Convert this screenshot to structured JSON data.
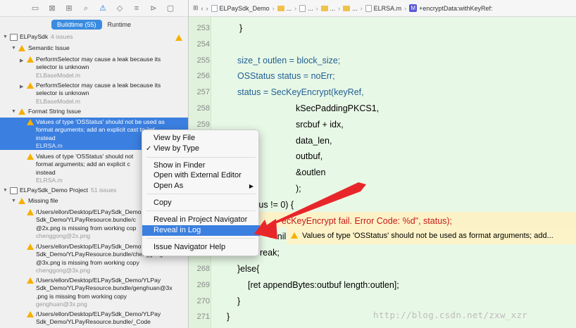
{
  "navigator": {
    "tabs": [
      "Buildtime (55)",
      "Runtime"
    ],
    "groups": [
      {
        "title": "ELPaySdk",
        "count": "4 issues"
      },
      {
        "title": "ELPaySdk_Demo Project",
        "count": "51 issues"
      }
    ],
    "sections": [
      "Semantic Issue",
      "Format String Issue",
      "Missing file"
    ],
    "issues": [
      {
        "l1": "PerformSelector may cause a leak because its",
        "l2": "selector is unknown",
        "file": "ELBaseModel.m"
      },
      {
        "l1": "PerformSelector may cause a leak because its",
        "l2": "selector is unknown",
        "file": "ELBaseModel.m"
      },
      {
        "l1": "Values of type 'OSStatus' should not be used as",
        "l2": "format arguments; add an explicit cast to 'int'",
        "l3": "instead",
        "file": "ELRSA.m"
      },
      {
        "l1": "Values of type 'OSStatus' should not",
        "l2": "format arguments; add an explicit c",
        "l3": "instead",
        "file": "ELRSA.m"
      },
      {
        "l1": "/Users/ellon/Desktop/ELPaySdk_Demo",
        "l2": "Sdk_Demo/YLPayResource.bundle/c",
        "l3": "@2x.png is missing from working cop",
        "file": "chenggong@2x.png"
      },
      {
        "l1": "/Users/ellon/Desktop/ELPaySdk_Demo",
        "l2": "Sdk_Demo/YLPayResource.bundle/chenggong",
        "l3": "@3x.png is missing from working copy",
        "file": "chenggong@3x.png"
      },
      {
        "l1": "/Users/ellon/Desktop/ELPaySdk_Demo/YLPay",
        "l2": "Sdk_Demo/YLPayResource.bundle/genghuan@3x",
        "l3": ".png is missing from working copy",
        "file": "genghuan@3x.png"
      },
      {
        "l1": "/Users/ellon/Desktop/ELPaySdk_Demo/YLPay",
        "l2": "Sdk_Demo/YLPayResource.bundle/_Code",
        "l3": "",
        "file": ""
      }
    ]
  },
  "jumpbar": {
    "project": "ELPaySdk_Demo",
    "ellipsis": "...",
    "file": "ELRSA.m",
    "method_icon": "M",
    "method": "+encryptData:withKeyRef:"
  },
  "editor": {
    "line_numbers": [
      "253",
      "254",
      "255",
      "256",
      "257",
      "258",
      "259",
      "260",
      "261",
      "262",
      "263",
      "264",
      "265",
      "266",
      "267",
      "268",
      "269",
      "270",
      "271"
    ],
    "code_lines": [
      "}",
      "",
      "size_t outlen = block_size;",
      "OSStatus status = noErr;",
      "status = SecKeyEncrypt(keyRef,",
      "kSecPaddingPKCS1,",
      "srcbuf + idx,",
      "data_len,",
      "outbuf,",
      "&outlen",
      ");",
      "atus != 0) {",
      "ecKeyEncrypt fail. Error Code: %d\", status);",
      "= nil;",
      "reak;",
      "}else{",
      "[ret appendBytes:outbuf length:outlen];",
      "}",
      "}"
    ],
    "error_message": "Values of type 'OSStatus' should not be used as format arguments; add..."
  },
  "context_menu": {
    "items": [
      "View by File",
      "View by Type",
      "Show in Finder",
      "Open with External Editor",
      "Open As",
      "Copy",
      "Reveal in Project Navigator",
      "Reveal in Log",
      "Issue Navigator Help"
    ],
    "checked": "View by Type",
    "highlighted": "Reveal in Log",
    "submenu_indicator": "▶",
    "checkmark": "✓"
  },
  "watermark": "http://blog.csdn.net/zxw_xzr",
  "colors": {
    "accent": "#3b7fe0",
    "warning": "#f5b000",
    "arrow": "#e8262a",
    "editor_bg": "#e8f8e6"
  }
}
